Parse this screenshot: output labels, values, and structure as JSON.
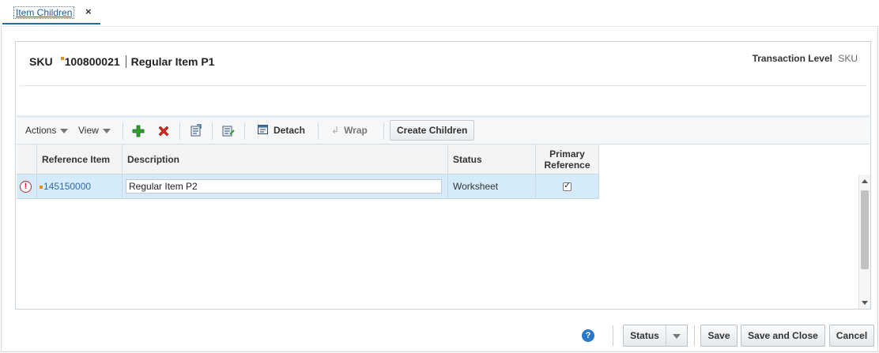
{
  "tab": {
    "label": "Item Children",
    "close": "×"
  },
  "header": {
    "sku_label": "SKU",
    "sku_value": "100800021",
    "item_name": "Regular Item P1",
    "transaction_level_label": "Transaction Level",
    "transaction_level_value": "SKU"
  },
  "toolbar": {
    "actions_label": "Actions",
    "view_label": "View",
    "detach_label": "Detach",
    "wrap_label": "Wrap",
    "create_children_label": "Create Children"
  },
  "table": {
    "columns": {
      "reference_item": "Reference Item",
      "description": "Description",
      "status": "Status",
      "primary_reference_line1": "Primary",
      "primary_reference_line2": "Reference"
    },
    "rows": [
      {
        "error_icon": "!",
        "reference_item": "145150000",
        "description": "Regular Item P2",
        "status": "Worksheet",
        "primary_reference_checked": true
      }
    ]
  },
  "footer": {
    "help_icon": "?",
    "status_label": "Status",
    "save_label": "Save",
    "save_close_label": "Save and Close",
    "cancel_label": "Cancel"
  },
  "colors": {
    "accent": "#1e6ea8",
    "link": "#2c6ca8",
    "marker": "#ef8a1c",
    "selected_row": "#d6ebfa",
    "error": "#c0262b"
  }
}
